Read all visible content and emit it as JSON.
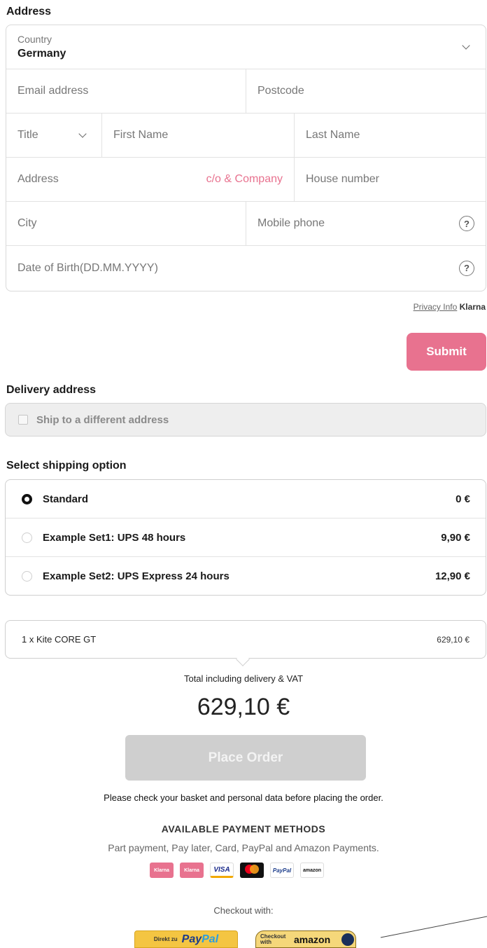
{
  "address_section": {
    "title": "Address",
    "country_label": "Country",
    "country_value": "Germany",
    "email_placeholder": "Email address",
    "postcode_placeholder": "Postcode",
    "title_select": "Title",
    "first_name_placeholder": "First Name",
    "last_name_placeholder": "Last Name",
    "address_placeholder": "Address",
    "co_company_link": "c/o & Company",
    "house_number_placeholder": "House number",
    "city_placeholder": "City",
    "mobile_placeholder": "Mobile phone",
    "dob_placeholder": "Date of Birth(DD.MM.YYYY)",
    "help_symbol": "?"
  },
  "privacy": {
    "link": "Privacy Info",
    "brand": "Klarna"
  },
  "submit_label": "Submit",
  "delivery": {
    "title": "Delivery address",
    "ship_different_label": "Ship to a different address"
  },
  "shipping": {
    "title": "Select shipping option",
    "options": [
      {
        "name": "Standard",
        "price": "0 €",
        "selected": true
      },
      {
        "name": "Example Set1: UPS 48 hours",
        "price": "9,90 €",
        "selected": false
      },
      {
        "name": "Example Set2: UPS Express 24 hours",
        "price": "12,90 €",
        "selected": false
      }
    ]
  },
  "basket": {
    "item": "1 x Kite CORE GT",
    "price": "629,10 €"
  },
  "total": {
    "label": "Total including delivery & VAT",
    "value": "629,10 €"
  },
  "place_order_label": "Place Order",
  "check_note": "Please check your basket and personal data before placing the order.",
  "payment_methods": {
    "title": "AVAILABLE PAYMENT METHODS",
    "subtitle": "Part payment, Pay later, Card, PayPal and Amazon Payments.",
    "logos": [
      "Klarna",
      "Klarna",
      "VISA",
      "mastercard",
      "PayPal",
      "amazon"
    ]
  },
  "checkout_with": {
    "label": "Checkout with:",
    "paypal_prefix": "Direkt zu",
    "paypal_pay": "Pay",
    "paypal_pal": "Pal",
    "amazon_text": "Checkout with",
    "amazon_brand": "amazon"
  },
  "colors": {
    "accent": "#e8728f",
    "disabled": "#cfcfcf"
  }
}
